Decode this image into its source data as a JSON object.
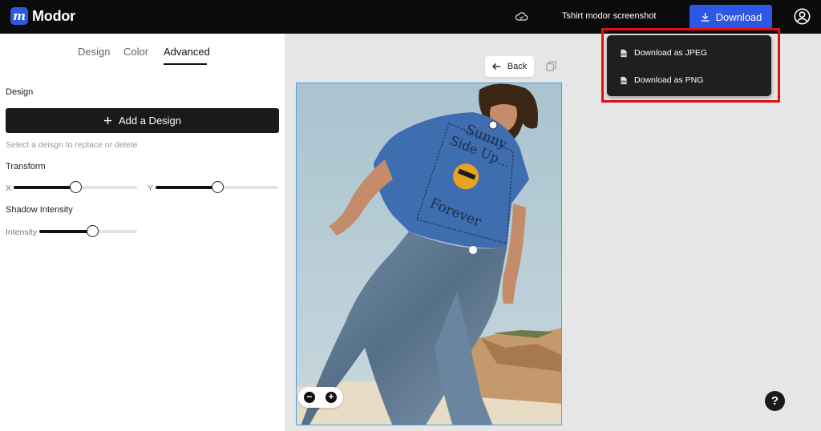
{
  "app": {
    "logo_letter": "m",
    "name": "Modor",
    "brand_color": "#2f57e6"
  },
  "header": {
    "document_title": "Tshirt modor screenshot",
    "download_label": "Download",
    "icons": [
      "cloud-icon",
      "download-icon",
      "user-circle-icon"
    ]
  },
  "tabs": [
    {
      "label": "Design",
      "active": false
    },
    {
      "label": "Color",
      "active": false
    },
    {
      "label": "Advanced",
      "active": true
    }
  ],
  "panel": {
    "design_section": "Design",
    "add_design_label": "Add a Design",
    "hint": "Select a deisgn to replace or delete",
    "transform_section": "Transform",
    "x_label": "X",
    "y_label": "Y",
    "x_value": 0.5,
    "y_value": 0.5,
    "shadow_section": "Shadow Intensity",
    "intensity_label": "Intensity",
    "intensity_value": 0.54
  },
  "canvas": {
    "back_label": "Back",
    "zoom_out": "−",
    "zoom_in": "+",
    "help": "?",
    "shirt_print": {
      "line1": "Sunny",
      "line2": "Side Up...",
      "line3": "Forever"
    }
  },
  "download_menu": {
    "items": [
      {
        "label": "Download as JPEG",
        "icon": "jpg-file-icon"
      },
      {
        "label": "Download as PNG",
        "icon": "png-file-icon"
      }
    ],
    "highlight_color": "#e01010"
  }
}
